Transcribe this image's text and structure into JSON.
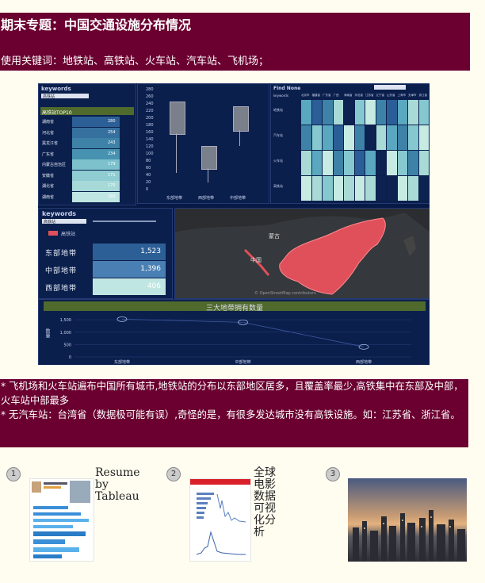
{
  "title": "期末专题：中国交通设施分布情况",
  "keywords_line": "使用关键词：地铁站、高铁站、火车站、汽车站、飞机场；",
  "dashboard": {
    "top_left_title": "keywords",
    "top_left_sub": "高铁站",
    "top10_title": "高铁站TOP10",
    "top10": [
      {
        "name": "湖南省",
        "value": "280"
      },
      {
        "name": "河北省",
        "value": "254"
      },
      {
        "name": "黑龙江省",
        "value": "243"
      },
      {
        "name": "广东省",
        "value": "234"
      },
      {
        "name": "内蒙古自治区",
        "value": "179"
      },
      {
        "name": "安徽省",
        "value": "171"
      },
      {
        "name": "湖北省",
        "value": "170"
      },
      {
        "name": "湖南省",
        "value": "160"
      }
    ],
    "boxplot_yticks": [
      "280",
      "260",
      "240",
      "220",
      "200",
      "180",
      "160",
      "140",
      "120",
      "100",
      "80",
      "60",
      "40",
      "20",
      "0"
    ],
    "boxplot_xlabels": [
      "东部地带",
      "西部地带",
      "中部地带"
    ],
    "heatmap_title": "Find None",
    "heatmap_col_label": "keywords",
    "heatmap_rows": [
      "地铁站",
      "汽车站",
      "火车站",
      "高铁站"
    ],
    "heatmap_cols": [
      "北京市",
      "福建省",
      "广东省",
      "广西",
      "海南省",
      "河北省",
      "江苏省",
      "辽宁省",
      "山东省",
      "上海市",
      "天津市",
      "浙江省"
    ],
    "region_title": "keywords",
    "region_sub": "高铁站",
    "region_legend": "高铁站",
    "regions": [
      {
        "name": "东部地带",
        "value": "1,523"
      },
      {
        "name": "中部地带",
        "value": "1,396"
      },
      {
        "name": "西部地带",
        "value": "406"
      }
    ],
    "map_labels": {
      "china": "中国",
      "mongolia": "蒙古",
      "credit": "© OpenStreetMap contributors"
    },
    "line_title": "三大地带拥有数量",
    "line_yticks": [
      "1,500",
      "1,000",
      "500",
      "0"
    ],
    "line_ylabel": "数量",
    "line_xlabels": [
      "东部地带",
      "中部地带",
      "西部地带"
    ]
  },
  "chart_data": {
    "type": "line",
    "title": "三大地带拥有数量",
    "categories": [
      "东部地带",
      "中部地带",
      "西部地带"
    ],
    "values": [
      1523,
      1396,
      406
    ],
    "ylabel": "数量",
    "ylim": [
      0,
      1600
    ]
  },
  "findings": [
    "* 飞机场和火车站遍布中国所有城市,地铁站的分布以东部地区居多，且覆盖率最少,高铁集中在东部及中部，火车站中部最多",
    "* 无汽车站：台湾省（数据极可能有误）,奇怪的是，有很多发达城市没有高铁设施。如：江苏省、浙江省。"
  ],
  "thumbnails": [
    {
      "num": "1",
      "label": "Resume by Tableau"
    },
    {
      "num": "2",
      "label": "全球电影数据可视化分析"
    },
    {
      "num": "3",
      "label": ""
    }
  ],
  "colors": {
    "banner": "#6b0030",
    "background": "#fffdf0",
    "dashboard": "#071a46",
    "accent_red": "#e0505a"
  }
}
